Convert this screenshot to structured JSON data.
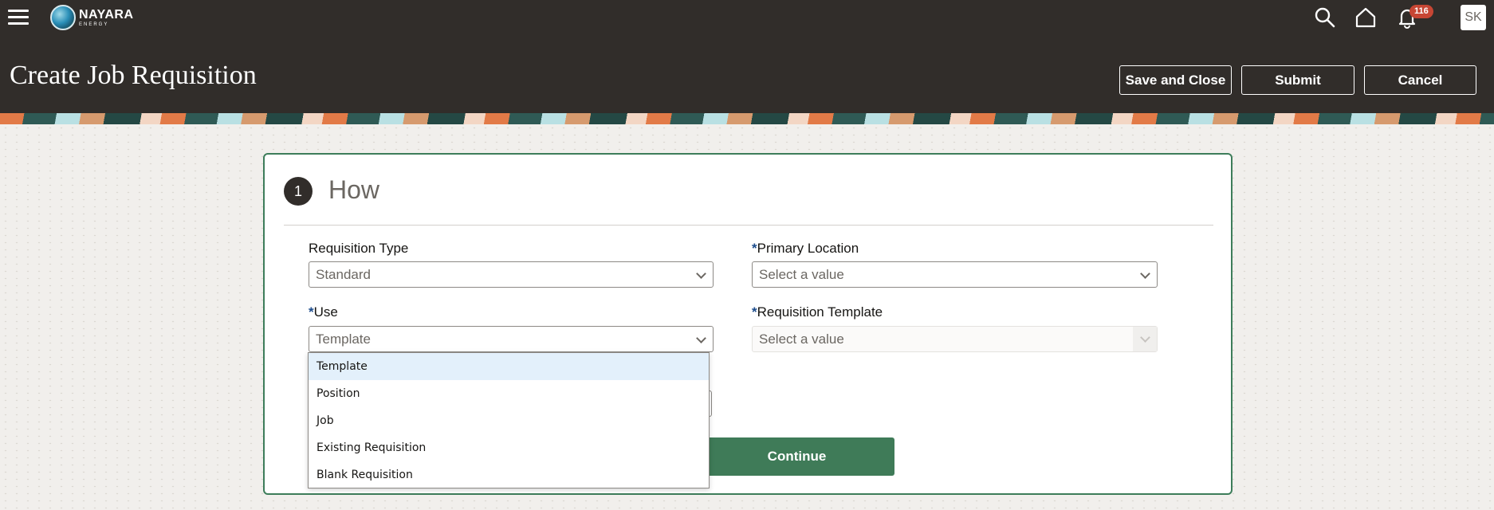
{
  "header": {
    "logo": {
      "name": "NAYARA",
      "sub": "ENERGY"
    },
    "notifications_count": "116",
    "avatar_initials": "SK",
    "page_title": "Create Job Requisition",
    "buttons": {
      "save_close": "Save and Close",
      "submit": "Submit",
      "cancel": "Cancel"
    }
  },
  "step": {
    "number": "1",
    "title": "How"
  },
  "form": {
    "requisition_type": {
      "label": "Requisition Type",
      "value": "Standard"
    },
    "primary_location": {
      "required_mark": "*",
      "label": "Primary Location",
      "value": "Select a value"
    },
    "use": {
      "required_mark": "*",
      "label": "Use",
      "value": "Template"
    },
    "requisition_template": {
      "required_mark": "*",
      "label": "Requisition Template",
      "value": "Select a value"
    },
    "continue_label": "Continue"
  },
  "use_dropdown": {
    "options": [
      "Template",
      "Position",
      "Job",
      "Existing Requisition",
      "Blank Requisition"
    ],
    "selected_index": 0
  },
  "colors": {
    "header_bg": "#312d2a",
    "accent_green": "#3f7b58",
    "badge_red": "#c74634",
    "required_blue": "#1c4c8c"
  }
}
